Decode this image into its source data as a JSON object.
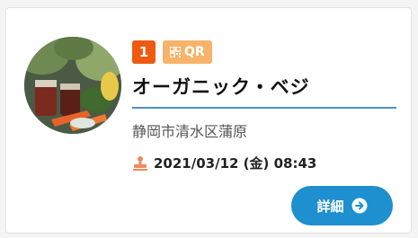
{
  "card": {
    "rank_badge": "1",
    "qr_badge": "QR",
    "shop_name": "オーガニック・ベジ",
    "address": "静岡市清水区蒲原",
    "datetime": "2021/03/12 (金) 08:43",
    "detail_button": "詳細"
  },
  "icons": {
    "qr": "qr-code-icon",
    "stamp": "stamp-icon",
    "arrow": "arrow-right-circle-icon"
  },
  "colors": {
    "rank_badge": "#ee5a12",
    "qr_badge": "#f6b36a",
    "divider": "#4f8fc8",
    "button": "#1e8fcf",
    "stamp": "#f08a5d"
  }
}
